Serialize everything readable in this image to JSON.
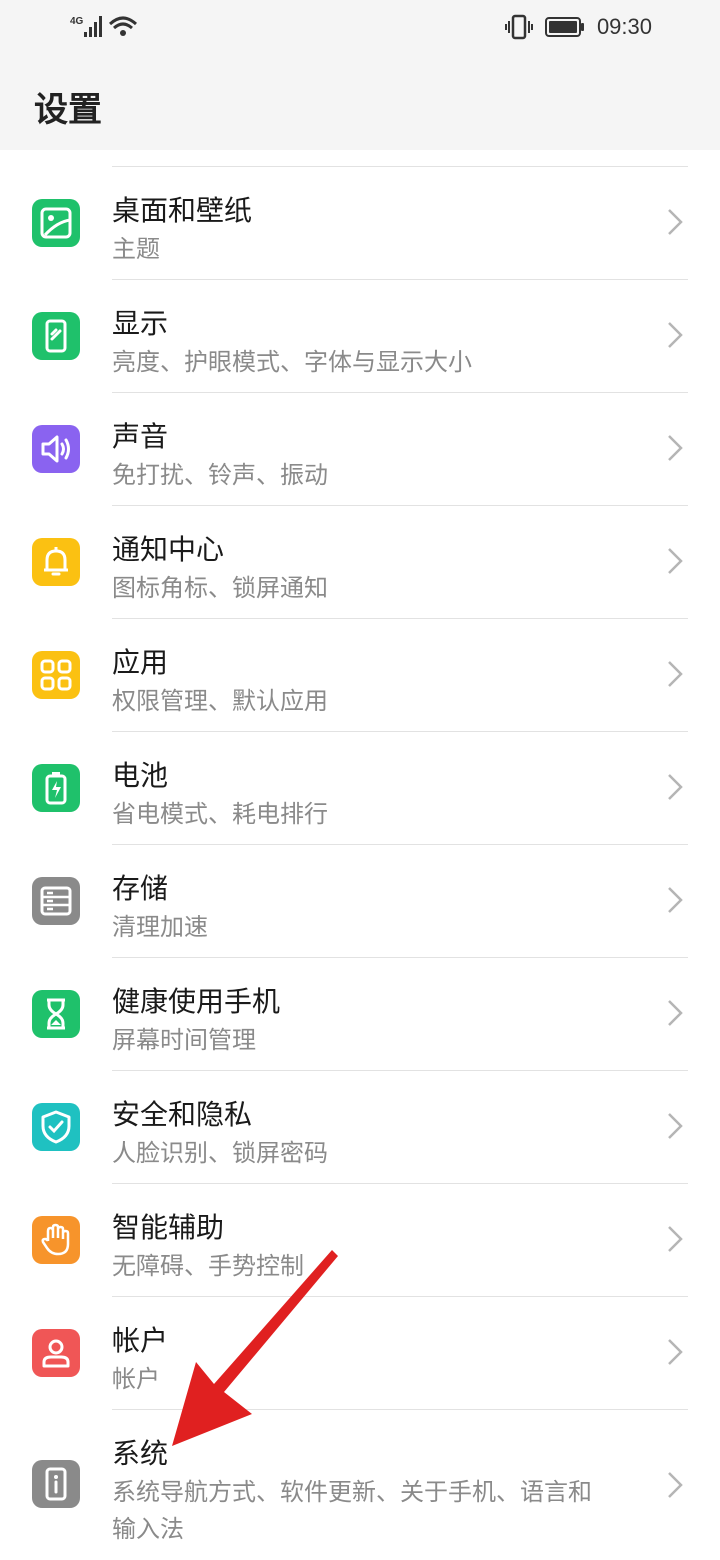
{
  "status_bar": {
    "network_label": "4G",
    "time": "09:30"
  },
  "header": {
    "title": "设置"
  },
  "items": [
    {
      "id": "wallpaper",
      "title": "桌面和壁纸",
      "subtitle": "主题",
      "icon": "wallpaper-icon",
      "color": "#1fc16b"
    },
    {
      "id": "display",
      "title": "显示",
      "subtitle": "亮度、护眼模式、字体与显示大小",
      "icon": "display-icon",
      "color": "#1fc16b"
    },
    {
      "id": "sound",
      "title": "声音",
      "subtitle": "免打扰、铃声、振动",
      "icon": "speaker-icon",
      "color": "#8a63f0"
    },
    {
      "id": "notification",
      "title": "通知中心",
      "subtitle": "图标角标、锁屏通知",
      "icon": "bell-icon",
      "color": "#fbc112"
    },
    {
      "id": "apps",
      "title": "应用",
      "subtitle": "权限管理、默认应用",
      "icon": "apps-grid-icon",
      "color": "#fbc112"
    },
    {
      "id": "battery",
      "title": "电池",
      "subtitle": "省电模式、耗电排行",
      "icon": "battery-icon",
      "color": "#1fc16b"
    },
    {
      "id": "storage",
      "title": "存储",
      "subtitle": "清理加速",
      "icon": "storage-icon",
      "color": "#8a8a8a"
    },
    {
      "id": "digital-balance",
      "title": "健康使用手机",
      "subtitle": "屏幕时间管理",
      "icon": "hourglass-icon",
      "color": "#1fc16b"
    },
    {
      "id": "security",
      "title": "安全和隐私",
      "subtitle": "人脸识别、锁屏密码",
      "icon": "shield-icon",
      "color": "#1fc1c1"
    },
    {
      "id": "accessibility",
      "title": "智能辅助",
      "subtitle": "无障碍、手势控制",
      "icon": "hand-icon",
      "color": "#f7942b"
    },
    {
      "id": "account",
      "title": "帐户",
      "subtitle": "帐户",
      "icon": "user-icon",
      "color": "#f05656"
    },
    {
      "id": "system",
      "title": "系统",
      "subtitle": "系统导航方式、软件更新、关于手机、语言和",
      "subtitle2": "输入法",
      "icon": "info-icon",
      "color": "#8a8a8a"
    }
  ],
  "annotation": {
    "arrow_color": "#e02020"
  }
}
